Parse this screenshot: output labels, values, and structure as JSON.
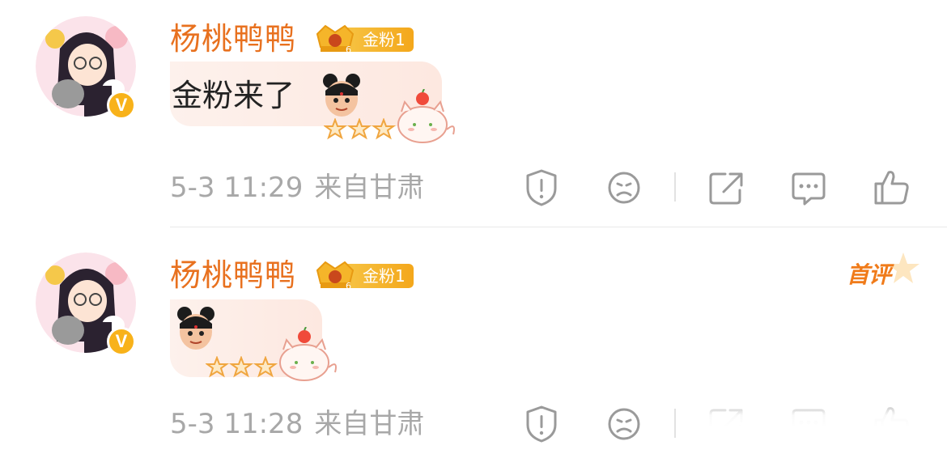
{
  "comments": [
    {
      "username": "杨桃鸭鸭",
      "fan_badge": "金粉1",
      "verified_mark": "V",
      "text": "金粉来了",
      "time": "5-3 11:29",
      "location": "来自甘肃",
      "first_badge": ""
    },
    {
      "username": "杨桃鸭鸭",
      "fan_badge": "金粉1",
      "verified_mark": "V",
      "text": "",
      "time": "5-3 11:28",
      "location": "来自甘肃",
      "first_badge": "首评"
    }
  ],
  "icons": {
    "report": "report-shield-icon",
    "dislike": "sad-face-icon",
    "share": "share-icon",
    "comment": "comment-icon",
    "like": "thumbs-up-icon"
  },
  "colors": {
    "username": "#e8711f",
    "badge": "#f4a71b",
    "meta": "#a8a8a8",
    "bubble": "#fdeee8",
    "verified": "#f8b21a"
  }
}
